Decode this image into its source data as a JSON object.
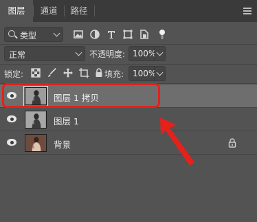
{
  "tabs": [
    {
      "label": "图层"
    },
    {
      "label": "通道"
    },
    {
      "label": "路径"
    }
  ],
  "filter": {
    "label": "类型"
  },
  "blend": {
    "mode": "正常",
    "opacity_label": "不透明度:",
    "opacity_value": "100%"
  },
  "lock_row": {
    "label": "锁定:",
    "fill_label": "填充:",
    "fill_value": "100%"
  },
  "layers": [
    {
      "name": "图层 1 拷贝",
      "selected": true
    },
    {
      "name": "图层 1",
      "selected": false
    },
    {
      "name": "背景",
      "selected": false,
      "locked": true
    }
  ],
  "colors": {
    "panel": "#535353",
    "tabbar": "#3a3a3a",
    "selected_row": "#6e6e6e",
    "annotation": "#e4211b"
  },
  "icons": {
    "filter_row": [
      "image-filter-icon",
      "adjustment-filter-icon",
      "type-filter-icon",
      "shape-filter-icon",
      "smart-object-filter-icon",
      "filter-toggle-icon"
    ],
    "lock_row": [
      "lock-transparent-pixels-icon",
      "lock-image-pixels-icon",
      "lock-position-icon",
      "lock-artboard-icon",
      "lock-all-icon"
    ]
  }
}
